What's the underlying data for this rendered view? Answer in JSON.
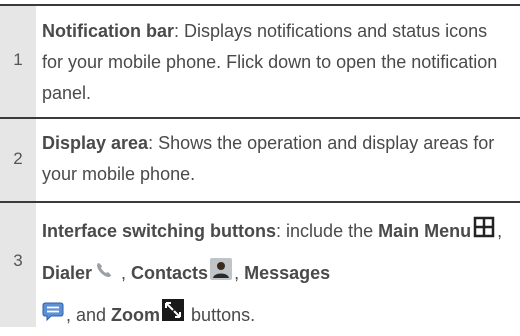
{
  "rows": [
    {
      "number": "1",
      "title": "Notification bar",
      "text": ": Displays notifications and status icons for your mobile phone. Flick down to open the notification panel."
    },
    {
      "number": "2",
      "title": "Display area",
      "text": ": Shows the operation and display areas for your mobile phone."
    },
    {
      "number": "3",
      "title": "Interface switching buttons",
      "text_1": ": include the ",
      "main_menu": "Main Menu",
      "sep_1": ", ",
      "dialer": "Dialer",
      "sep_2": " , ",
      "contacts": "Contacts",
      "sep_3": ", ",
      "messages": "Messages",
      "sep_4": ", and ",
      "zoom": "Zoom",
      "text_end": " buttons."
    }
  ],
  "icons": {
    "main_menu": "grid-icon",
    "dialer": "phone-handset-icon",
    "contacts": "person-icon",
    "messages": "message-bubble-icon",
    "zoom": "zoom-arrows-icon"
  }
}
